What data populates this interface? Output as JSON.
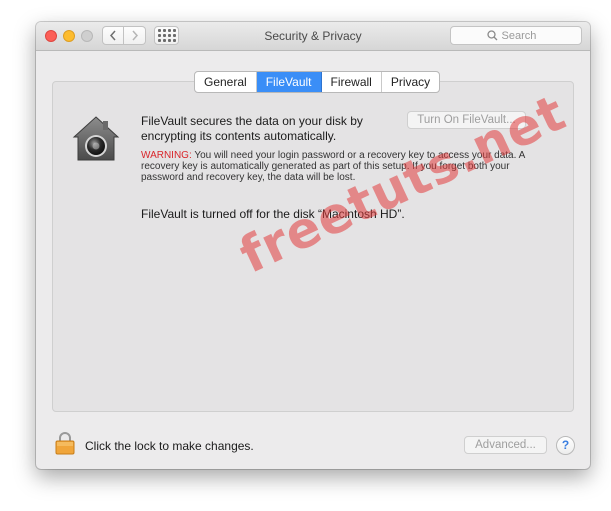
{
  "window": {
    "title": "Security & Privacy"
  },
  "toolbar": {
    "back_icon": "chevron-left-icon",
    "forward_icon": "chevron-right-icon",
    "show_all_icon": "grid-icon",
    "search_placeholder": "Search"
  },
  "tabs": [
    {
      "label": "General",
      "active": false
    },
    {
      "label": "FileVault",
      "active": true
    },
    {
      "label": "Firewall",
      "active": false
    },
    {
      "label": "Privacy",
      "active": false
    }
  ],
  "filevault": {
    "description": "FileVault secures the data on your disk by encrypting its contents automatically.",
    "turn_on_label": "Turn On FileVault...",
    "warning_label": "WARNING:",
    "warning_text": " You will need your login password or a recovery key to access your data. A recovery key is automatically generated as part of this setup. If you forget both your password and recovery key, the data will be lost.",
    "status": "FileVault is turned off for the disk “Macintosh HD”."
  },
  "footer": {
    "lock_text": "Click the lock to make changes.",
    "advanced_label": "Advanced...",
    "help_label": "?"
  },
  "watermark": "freetuts.net",
  "colors": {
    "accent": "#3a8ef7",
    "warning": "#d9262b",
    "close": "#fc5f57",
    "minimize": "#fdbc2e",
    "zoom_disabled": "#cfcfcf"
  }
}
